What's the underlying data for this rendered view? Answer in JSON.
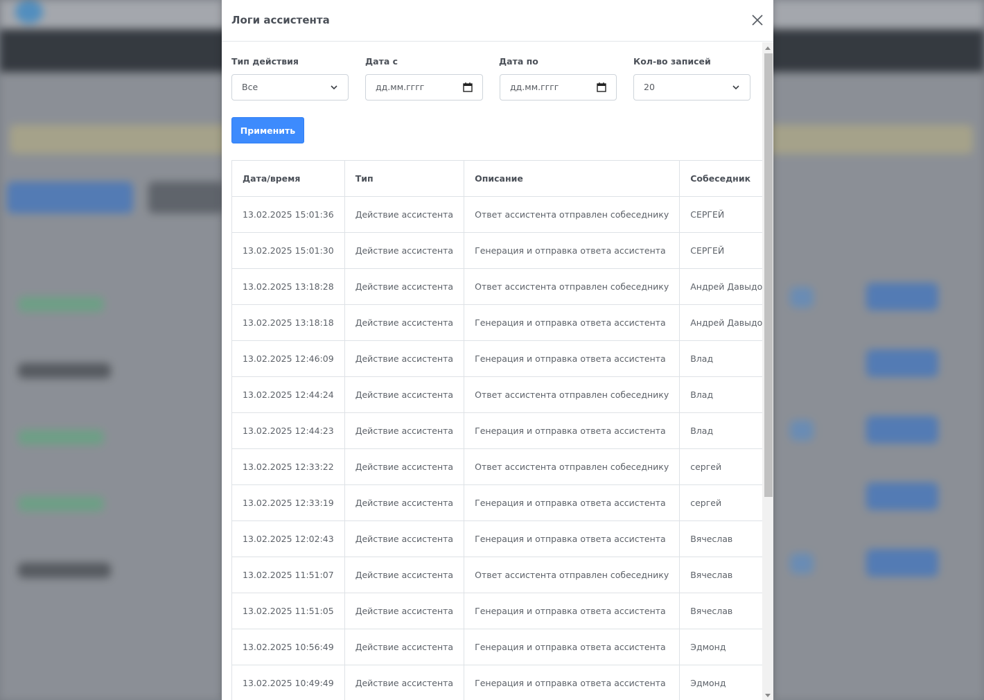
{
  "modal": {
    "title": "Логи ассистента",
    "close_icon": "close-icon"
  },
  "filters": {
    "action_type": {
      "label": "Тип действия",
      "value": "Все"
    },
    "date_from": {
      "label": "Дата с",
      "placeholder": "дд.мм.гггг"
    },
    "date_to": {
      "label": "Дата по",
      "placeholder": "дд.мм.гггг"
    },
    "records_count": {
      "label": "Кол-во записей",
      "value": "20"
    },
    "apply_label": "Применить"
  },
  "table": {
    "columns": [
      "Дата/время",
      "Тип",
      "Описание",
      "Собеседник"
    ],
    "rows": [
      [
        "13.02.2025 15:01:36",
        "Действие ассистента",
        "Ответ ассистента отправлен собеседнику",
        "СЕРГЕЙ"
      ],
      [
        "13.02.2025 15:01:30",
        "Действие ассистента",
        "Генерация и отправка ответа ассистента",
        "СЕРГЕЙ"
      ],
      [
        "13.02.2025 13:18:28",
        "Действие ассистента",
        "Ответ ассистента отправлен собеседнику",
        "Андрей Давыдов"
      ],
      [
        "13.02.2025 13:18:18",
        "Действие ассистента",
        "Генерация и отправка ответа ассистента",
        "Андрей Давыдов"
      ],
      [
        "13.02.2025 12:46:09",
        "Действие ассистента",
        "Генерация и отправка ответа ассистента",
        "Влад"
      ],
      [
        "13.02.2025 12:44:24",
        "Действие ассистента",
        "Ответ ассистента отправлен собеседнику",
        "Влад"
      ],
      [
        "13.02.2025 12:44:23",
        "Действие ассистента",
        "Генерация и отправка ответа ассистента",
        "Влад"
      ],
      [
        "13.02.2025 12:33:22",
        "Действие ассистента",
        "Ответ ассистента отправлен собеседнику",
        "сергей"
      ],
      [
        "13.02.2025 12:33:19",
        "Действие ассистента",
        "Генерация и отправка ответа ассистента",
        "сергей"
      ],
      [
        "13.02.2025 12:02:43",
        "Действие ассистента",
        "Генерация и отправка ответа ассистента",
        "Вячеслав"
      ],
      [
        "13.02.2025 11:51:07",
        "Действие ассистента",
        "Ответ ассистента отправлен собеседнику",
        "Вячеслав"
      ],
      [
        "13.02.2025 11:51:05",
        "Действие ассистента",
        "Генерация и отправка ответа ассистента",
        "Вячеслав"
      ],
      [
        "13.02.2025 10:56:49",
        "Действие ассистента",
        "Генерация и отправка ответа ассистента",
        "Эдмонд"
      ],
      [
        "13.02.2025 10:49:49",
        "Действие ассистента",
        "Генерация и отправка ответа ассистента",
        "Эдмонд"
      ]
    ]
  },
  "colors": {
    "primary": "#3d8bfd",
    "border": "#dee2e6",
    "text": "#5c6168"
  }
}
